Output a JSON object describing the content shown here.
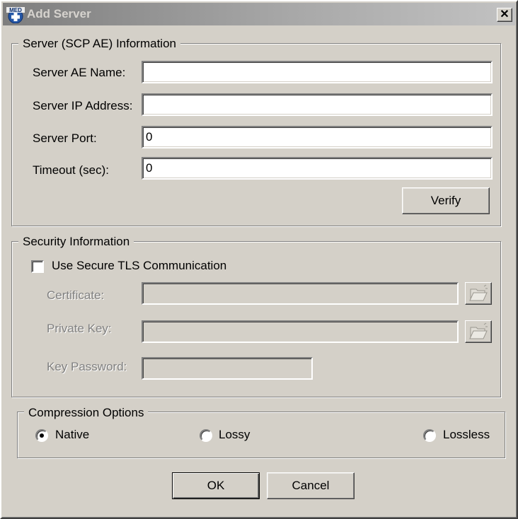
{
  "window": {
    "title": "Add Server",
    "icon_label": "MED",
    "close_glyph": "✕"
  },
  "server_group": {
    "legend": "Server (SCP AE) Information",
    "ae_name": {
      "label": "Server AE Name:",
      "value": ""
    },
    "ip_address": {
      "label": "Server IP Address:",
      "value": ""
    },
    "port": {
      "label": "Server Port:",
      "value": "0"
    },
    "timeout": {
      "label": "Timeout (sec):",
      "value": "0"
    },
    "verify_label": "Verify"
  },
  "security_group": {
    "legend": "Security Information",
    "use_tls": {
      "label": "Use Secure TLS Communication",
      "checked": false
    },
    "certificate": {
      "label": "Certificate:",
      "value": ""
    },
    "private_key": {
      "label": "Private Key:",
      "value": ""
    },
    "key_password": {
      "label": "Key Password:",
      "value": ""
    },
    "browse_icon": "folder-open-icon"
  },
  "compression_group": {
    "legend": "Compression Options",
    "options": [
      {
        "label": "Native",
        "selected": true
      },
      {
        "label": "Lossy",
        "selected": false
      },
      {
        "label": "Lossless",
        "selected": false
      }
    ]
  },
  "buttons": {
    "ok_label": "OK",
    "cancel_label": "Cancel"
  },
  "colors": {
    "face": "#d4d0c8",
    "titlebar_start": "#7e7e7e",
    "titlebar_end": "#c2c2c2",
    "disabled_text": "#808080"
  }
}
